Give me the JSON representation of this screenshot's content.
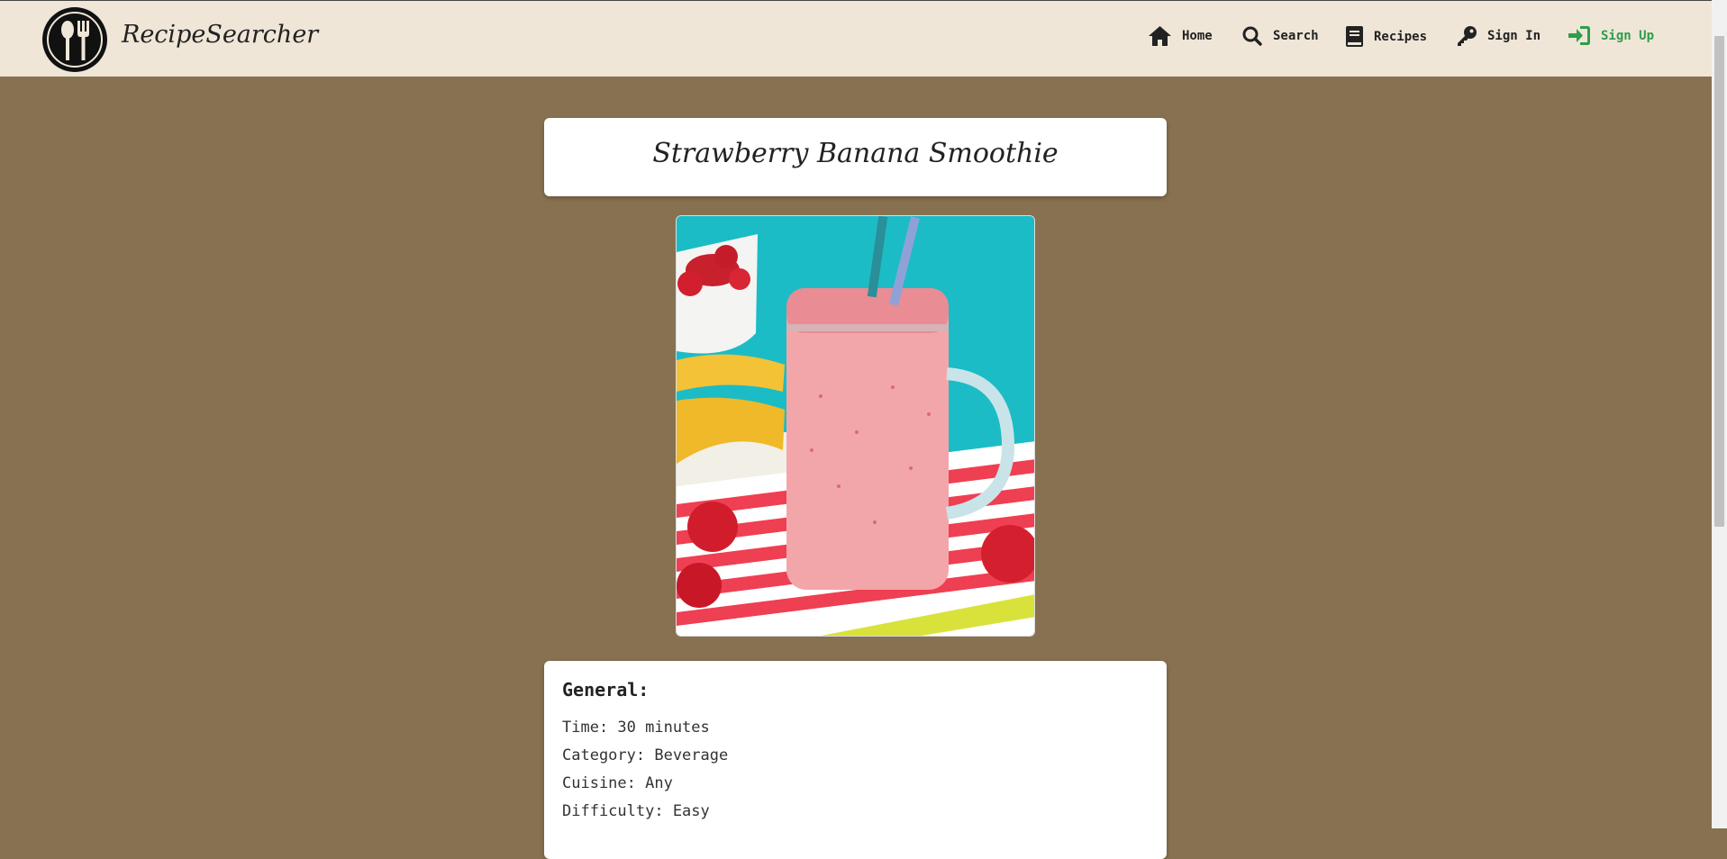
{
  "header": {
    "brand": "RecipeSearcher",
    "nav": [
      {
        "label": "Home",
        "icon": "home-icon"
      },
      {
        "label": "Search",
        "icon": "search-icon"
      },
      {
        "label": "Recipes",
        "icon": "book-icon"
      },
      {
        "label": "Sign In",
        "icon": "key-icon"
      },
      {
        "label": "Sign Up",
        "icon": "sign-in-arrow-icon"
      }
    ]
  },
  "recipe": {
    "title": "Strawberry Banana Smoothie",
    "image": "strawberry-banana-smoothie-photo",
    "general_heading": "General:",
    "details": [
      "Time: 30 minutes",
      "Category: Beverage",
      "Cuisine: Any",
      "Difficulty: Easy"
    ]
  },
  "colors": {
    "background": "#877150",
    "navbar": "#efe6d8",
    "signup": "#2e9e4a",
    "card": "#ffffff"
  }
}
